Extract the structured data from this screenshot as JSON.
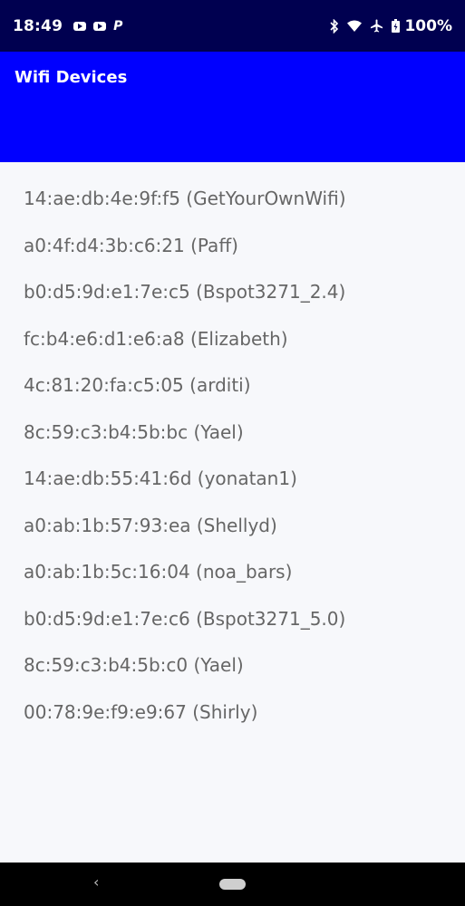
{
  "status_bar": {
    "time": "18:49",
    "battery": "100%",
    "notification_icons": [
      "youtube-icon",
      "youtube-icon",
      "parking-icon"
    ],
    "p_glyph": "P"
  },
  "app_bar": {
    "title": "Wifi Devices",
    "color": "#0000ff"
  },
  "devices": [
    "14:ae:db:4e:9f:f5 (GetYourOwnWifi)",
    "a0:4f:d4:3b:c6:21 (Paff)",
    "b0:d5:9d:e1:7e:c5 (Bspot3271_2.4)",
    "fc:b4:e6:d1:e6:a8 (Elizabeth)",
    "4c:81:20:fa:c5:05 (arditi)",
    "8c:59:c3:b4:5b:bc (Yael)",
    "14:ae:db:55:41:6d (yonatan1)",
    "a0:ab:1b:57:93:ea (Shellyd)",
    "a0:ab:1b:5c:16:04 (noa_bars)",
    "b0:d5:9d:e1:7e:c6 (Bspot3271_5.0)",
    "8c:59:c3:b4:5b:c0 (Yael)",
    "00:78:9e:f9:e9:67 (Shirly)"
  ],
  "nav_bar": {
    "back_glyph": "‹"
  }
}
